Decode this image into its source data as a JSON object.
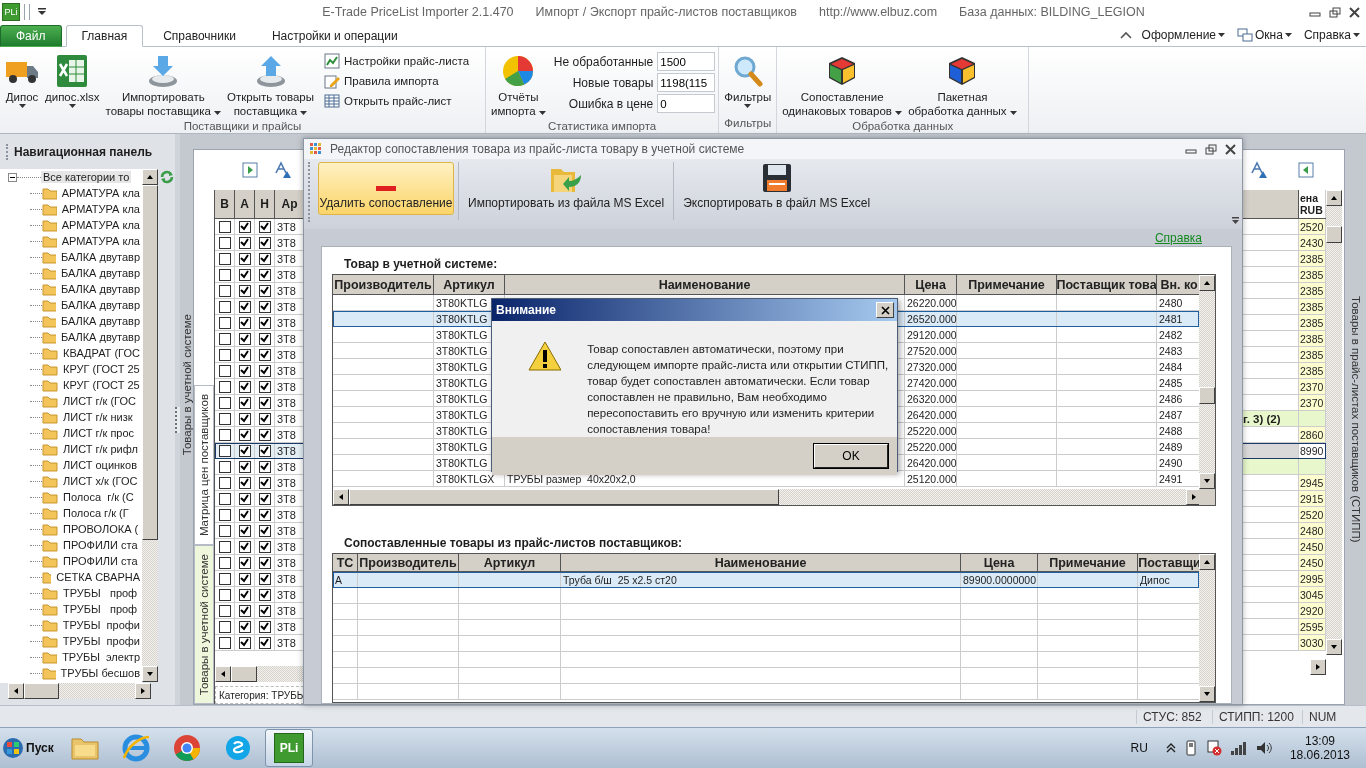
{
  "title_bar": {
    "app_badge": "PLi",
    "texts": [
      "E-Trade PriceList Importer 2.1.470",
      "Импорт / Экспорт прайс-листов поставщиков",
      "http://www.elbuz.com",
      "База данных: BILDING_LEGION"
    ]
  },
  "ribbon": {
    "tabs": [
      {
        "label": "Файл",
        "kind": "file",
        "selected": false
      },
      {
        "label": "Главная",
        "kind": "tab",
        "selected": true
      },
      {
        "label": "Справочники",
        "kind": "tab",
        "selected": false
      },
      {
        "label": "Настройки и операции",
        "kind": "tab",
        "selected": false
      }
    ],
    "menus": [
      "Оформление",
      "Окна",
      "Справка"
    ],
    "groups": [
      {
        "label": "Поставщики и прайсы",
        "items": [
          {
            "kind": "large",
            "lines": [
              "Дипос"
            ],
            "dropdown": true
          },
          {
            "kind": "large",
            "lines": [
              "дипос.xlsx"
            ],
            "dropdown": true
          },
          {
            "kind": "large",
            "lines": [
              "Импортировать",
              "товары поставщика"
            ],
            "dropdown": true
          },
          {
            "kind": "large",
            "lines": [
              "Открыть товары",
              "поставщика"
            ],
            "dropdown": true
          },
          {
            "kind": "stack",
            "buttons": [
              "Настройки прайс-листа",
              "Правила импорта",
              "Открыть прайс-лист"
            ]
          }
        ]
      },
      {
        "label": "Статистика импорта",
        "items": [
          {
            "kind": "large",
            "lines": [
              "Отчёты",
              "импорта"
            ],
            "dropdown": true
          },
          {
            "kind": "stats",
            "fields": [
              {
                "label": "Не обработанные",
                "value": "1500"
              },
              {
                "label": "Новые товары",
                "value": "1198(115"
              },
              {
                "label": "Ошибка в цене",
                "value": "0"
              }
            ]
          }
        ]
      },
      {
        "label": "Фильтры",
        "items": [
          {
            "kind": "large",
            "lines": [
              "Фильтры"
            ],
            "dropdown": true
          }
        ]
      },
      {
        "label": "Обработка данных",
        "items": [
          {
            "kind": "large",
            "lines": [
              "Сопоставление",
              "одинаковых товаров"
            ],
            "dropdown": true
          },
          {
            "kind": "large",
            "lines": [
              "Пакетная",
              "обработка данных"
            ],
            "dropdown": true
          }
        ]
      }
    ]
  },
  "nav": {
    "title": "Навигационная панель",
    "tree": [
      {
        "label": "Все категории то",
        "expanded": true,
        "selected": true,
        "children": [
          {
            "label": "АРМАТУРА кла",
            "selected": false
          },
          {
            "label": "АРМАТУРА кла",
            "selected": false
          },
          {
            "label": "АРМАТУРА кла",
            "selected": false
          },
          {
            "label": "АРМАТУРА кла",
            "selected": false
          },
          {
            "label": "БАЛКА двутавр",
            "selected": false
          },
          {
            "label": "БАЛКА двутавр",
            "selected": false
          },
          {
            "label": "БАЛКА двутавр",
            "selected": false
          },
          {
            "label": "БАЛКА двутавр",
            "selected": false
          },
          {
            "label": "БАЛКА двутавр",
            "selected": false
          },
          {
            "label": "БАЛКА двутавр",
            "selected": false
          },
          {
            "label": "КВАДРАТ (ГОС",
            "selected": false
          },
          {
            "label": "КРУГ (ГОСТ 25",
            "selected": false
          },
          {
            "label": "КРУГ (ГОСТ 25",
            "selected": false
          },
          {
            "label": "ЛИСТ г/к (ГОС",
            "selected": false
          },
          {
            "label": "ЛИСТ г/к низк",
            "selected": false
          },
          {
            "label": "ЛИСТ г/к прос",
            "selected": false
          },
          {
            "label": "ЛИСТ г/к рифл",
            "selected": false
          },
          {
            "label": "ЛИСТ оцинков",
            "selected": false
          },
          {
            "label": "ЛИСТ х/к (ГОС",
            "selected": false
          },
          {
            "label": "Полоса  г/к (С",
            "selected": false
          },
          {
            "label": "Полоса г/к (Г",
            "selected": false
          },
          {
            "label": "ПРОВОЛОКА (",
            "selected": false
          },
          {
            "label": "ПРОФИЛИ ста",
            "selected": false
          },
          {
            "label": "ПРОФИЛИ ста",
            "selected": false
          },
          {
            "label": "СЕТКА СВАРНА",
            "selected": false
          },
          {
            "label": "ТРУБЫ   проф",
            "selected": false
          },
          {
            "label": "ТРУБЫ   проф",
            "selected": false
          },
          {
            "label": "ТРУБЫ  профи",
            "selected": false
          },
          {
            "label": "ТРУБЫ  профи",
            "selected": false
          },
          {
            "label": "ТРУБЫ  электр",
            "selected": false
          },
          {
            "label": "ТРУБЫ бесшов",
            "selected": false
          }
        ]
      }
    ]
  },
  "workspace": {
    "outer_tab": "Товары в учетной системе",
    "tabs": [
      {
        "label": "Матрица цен поставщиков",
        "selected": true
      },
      {
        "label": "Товары в учетной системе",
        "selected": false
      }
    ],
    "right_tab": "Товары в прайс-листах поставщиков (СТИПП)",
    "left_grid": {
      "columns": [
        "В",
        "А",
        "Н",
        "Ар"
      ],
      "footer": "Категория: ТРУБЫ",
      "rows": [
        {
          "b": false,
          "a": true,
          "h": true,
          "article": "3T8",
          "selected": false
        },
        {
          "b": false,
          "a": true,
          "h": true,
          "article": "3T8",
          "selected": false
        },
        {
          "b": false,
          "a": true,
          "h": true,
          "article": "3T8",
          "selected": false
        },
        {
          "b": false,
          "a": true,
          "h": true,
          "article": "3T8",
          "selected": false
        },
        {
          "b": false,
          "a": true,
          "h": true,
          "article": "3T8",
          "selected": false
        },
        {
          "b": false,
          "a": true,
          "h": true,
          "article": "3T8",
          "selected": false
        },
        {
          "b": false,
          "a": true,
          "h": true,
          "article": "3T8",
          "selected": false
        },
        {
          "b": false,
          "a": true,
          "h": true,
          "article": "3T8",
          "selected": false
        },
        {
          "b": false,
          "a": true,
          "h": true,
          "article": "3T8",
          "selected": false
        },
        {
          "b": false,
          "a": true,
          "h": true,
          "article": "3T8",
          "selected": false
        },
        {
          "b": false,
          "a": true,
          "h": true,
          "article": "3T8",
          "selected": false
        },
        {
          "b": false,
          "a": true,
          "h": true,
          "article": "3T8",
          "selected": false
        },
        {
          "b": false,
          "a": true,
          "h": true,
          "article": "3T8",
          "selected": false
        },
        {
          "b": false,
          "a": true,
          "h": true,
          "article": "3T8",
          "selected": false
        },
        {
          "b": false,
          "a": true,
          "h": true,
          "article": "3T8",
          "selected": true
        },
        {
          "b": false,
          "a": true,
          "h": true,
          "article": "3T8",
          "selected": false
        },
        {
          "b": false,
          "a": true,
          "h": true,
          "article": "3T8",
          "selected": false
        },
        {
          "b": false,
          "a": true,
          "h": true,
          "article": "3T8",
          "selected": false
        },
        {
          "b": false,
          "a": true,
          "h": true,
          "article": "3T8",
          "selected": false
        },
        {
          "b": false,
          "a": true,
          "h": true,
          "article": "3T8",
          "selected": false
        },
        {
          "b": false,
          "a": true,
          "h": true,
          "article": "3T8",
          "selected": false
        },
        {
          "b": false,
          "a": true,
          "h": true,
          "article": "3T8",
          "selected": false
        },
        {
          "b": false,
          "a": true,
          "h": true,
          "article": "3T8",
          "selected": false
        },
        {
          "b": false,
          "a": true,
          "h": true,
          "article": "3T8",
          "selected": false
        },
        {
          "b": false,
          "a": true,
          "h": true,
          "article": "3T8",
          "selected": false
        },
        {
          "b": false,
          "a": true,
          "h": true,
          "article": "3T8",
          "selected": false
        },
        {
          "b": false,
          "a": true,
          "h": true,
          "article": "3T8",
          "selected": false
        }
      ]
    },
    "right_grid": {
      "column": "ена RUB",
      "rows": [
        {
          "kind": "price",
          "price": "2520",
          "selected": false
        },
        {
          "kind": "price",
          "price": "2430",
          "selected": false
        },
        {
          "kind": "price",
          "price": "2385",
          "selected": false
        },
        {
          "kind": "price",
          "price": "2385",
          "selected": false
        },
        {
          "kind": "price",
          "price": "2385",
          "selected": false
        },
        {
          "kind": "price",
          "price": "2385",
          "selected": false
        },
        {
          "kind": "price",
          "price": "2385",
          "selected": false
        },
        {
          "kind": "price",
          "price": "2385",
          "selected": false
        },
        {
          "kind": "price",
          "price": "2385",
          "selected": false
        },
        {
          "kind": "price",
          "price": "2385",
          "selected": false
        },
        {
          "kind": "price",
          "price": "2370",
          "selected": false
        },
        {
          "kind": "price",
          "price": "2370",
          "selected": false
        },
        {
          "kind": "group",
          "label": "г. 3) (2)",
          "selected": false
        },
        {
          "kind": "price",
          "price": "2860",
          "selected": false
        },
        {
          "kind": "price",
          "price": "8990",
          "selected": true
        },
        {
          "kind": "group",
          "selected": false
        },
        {
          "kind": "price",
          "price": "2945",
          "selected": false
        },
        {
          "kind": "price",
          "price": "2915",
          "selected": false
        },
        {
          "kind": "price",
          "price": "2520",
          "selected": false
        },
        {
          "kind": "price",
          "price": "2480",
          "selected": false
        },
        {
          "kind": "price",
          "price": "2450",
          "selected": false
        },
        {
          "kind": "price",
          "price": "2450",
          "selected": false
        },
        {
          "kind": "price",
          "price": "2995",
          "selected": false
        },
        {
          "kind": "price",
          "price": "3045",
          "selected": false
        },
        {
          "kind": "price",
          "price": "2920",
          "selected": false
        },
        {
          "kind": "price",
          "price": "2595",
          "selected": false
        },
        {
          "kind": "price",
          "price": "3030",
          "selected": false
        }
      ]
    }
  },
  "editor": {
    "title": "Редактор сопоставления товара из прайс-листа товару в учетной системе",
    "toolbar": [
      {
        "label": "Удалить сопоставление",
        "selected": true
      },
      {
        "label": "Импортировать из файла MS Excel",
        "selected": false
      },
      {
        "label": "Экспортировать в файл MS Excel",
        "selected": false
      }
    ],
    "help_link": "Справка",
    "system_table": {
      "title": "Товар в учетной системе:",
      "columns": [
        "Производитель",
        "Артикул",
        "Наименование",
        "Цена",
        "Примечание",
        "Поставщик това",
        "Вн. ко"
      ],
      "rows": [
        {
          "article": "3T80KTLG",
          "price": "26220.000",
          "code": "2480",
          "selected": false
        },
        {
          "article": "3T80KTLG",
          "price": "26520.000",
          "code": "2481",
          "selected": true
        },
        {
          "article": "3T80KTLG",
          "price": "29120.000",
          "code": "2482",
          "selected": false
        },
        {
          "article": "3T80KTLG",
          "price": "27520.000",
          "code": "2483",
          "selected": false
        },
        {
          "article": "3T80KTLG",
          "price": "27320.000",
          "code": "2484",
          "selected": false
        },
        {
          "article": "3T80KTLG",
          "price": "27420.000",
          "code": "2485",
          "selected": false
        },
        {
          "article": "3T80KTLG",
          "price": "26320.000",
          "code": "2486",
          "selected": false
        },
        {
          "article": "3T80KTLG",
          "price": "26420.000",
          "code": "2487",
          "selected": false
        },
        {
          "article": "3T80KTLG",
          "price": "25220.000",
          "code": "2488",
          "selected": false
        },
        {
          "article": "3T80KTLG",
          "price": "25220.000",
          "code": "2489",
          "selected": false
        },
        {
          "article": "3T80KTLG",
          "price": "26420.000",
          "code": "2490",
          "selected": false
        },
        {
          "article": "3T80KTLGX",
          "name": "ТРУБЫ размер  40х20х2,0",
          "price": "25120.000",
          "code": "2491",
          "selected": false
        }
      ]
    },
    "matched_table": {
      "title": "Сопоставленные товары из прайс-листов поставщиков:",
      "columns": [
        "ТС",
        "Производитель",
        "Артикул",
        "Наименование",
        "Цена",
        "Примечание",
        "Поставщи"
      ],
      "rows": [
        {
          "tc": "А",
          "name": "Труба б/ш  25 x2.5 ст20",
          "price": "89900.0000000",
          "supplier": "Дипос",
          "selected": true
        }
      ]
    }
  },
  "dialog": {
    "title": "Внимание",
    "message": "Товар сопоставлен автоматически, поэтому при следующем импорте прайс-листа или открытии СТИПП, товар будет сопоставлен автоматически. Если товар сопоставлен не правильно, Вам необходимо пересопоставить его вручную или изменить критерии сопоставления товара!",
    "button": "OK"
  },
  "status_bar": [
    "СТУС: 852",
    "СТИПП: 1200",
    "NUM"
  ],
  "taskbar": {
    "start": "Пуск",
    "apps": [
      {
        "selected": false
      },
      {
        "selected": false
      },
      {
        "selected": false
      },
      {
        "selected": false
      },
      {
        "label": "PLi",
        "selected": true
      }
    ],
    "language": "RU",
    "time": "13:09",
    "date": "18.06.2013"
  }
}
